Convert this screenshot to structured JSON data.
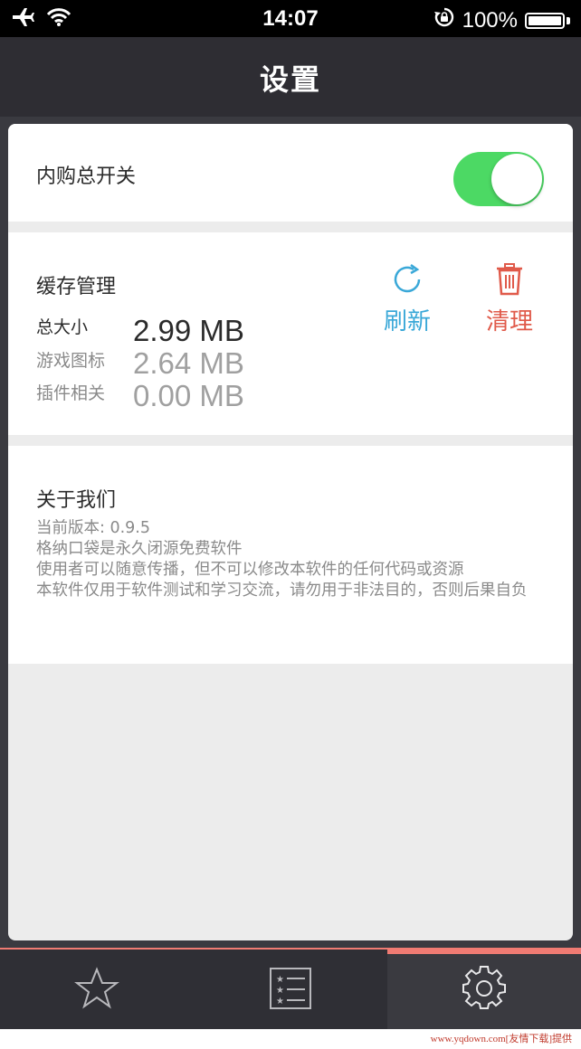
{
  "status_bar": {
    "time": "14:07",
    "battery": "100%",
    "icons": [
      "airplane-icon",
      "wifi-icon",
      "rotation-lock-icon",
      "battery-icon"
    ]
  },
  "nav": {
    "title": "设置"
  },
  "iap": {
    "label": "内购总开关",
    "enabled": true
  },
  "cache": {
    "title": "缓存管理",
    "rows": [
      {
        "label": "总大小",
        "value": "2.99 MB"
      },
      {
        "label": "游戏图标",
        "value": "2.64 MB"
      },
      {
        "label": "插件相关",
        "value": "0.00 MB"
      }
    ],
    "refresh_label": "刷新",
    "clear_label": "清理"
  },
  "about": {
    "title": "关于我们",
    "lines": [
      "当前版本: 0.9.5",
      "格纳口袋是永久闭源免费软件",
      "使用者可以随意传播，但不可以修改本软件的任何代码或资源",
      "本软件仅用于软件测试和学习交流，请勿用于非法目的，否则后果自负"
    ]
  },
  "tabs": [
    {
      "icon": "star-icon",
      "active": false
    },
    {
      "icon": "list-icon",
      "active": false
    },
    {
      "icon": "gear-icon",
      "active": true
    }
  ],
  "colors": {
    "toggle_on": "#4cd964",
    "refresh": "#3aa8d8",
    "clear": "#e05a4a",
    "tab_indicator": "#f07b73"
  },
  "watermark": "www.yqdown.com[友情下载]提供"
}
